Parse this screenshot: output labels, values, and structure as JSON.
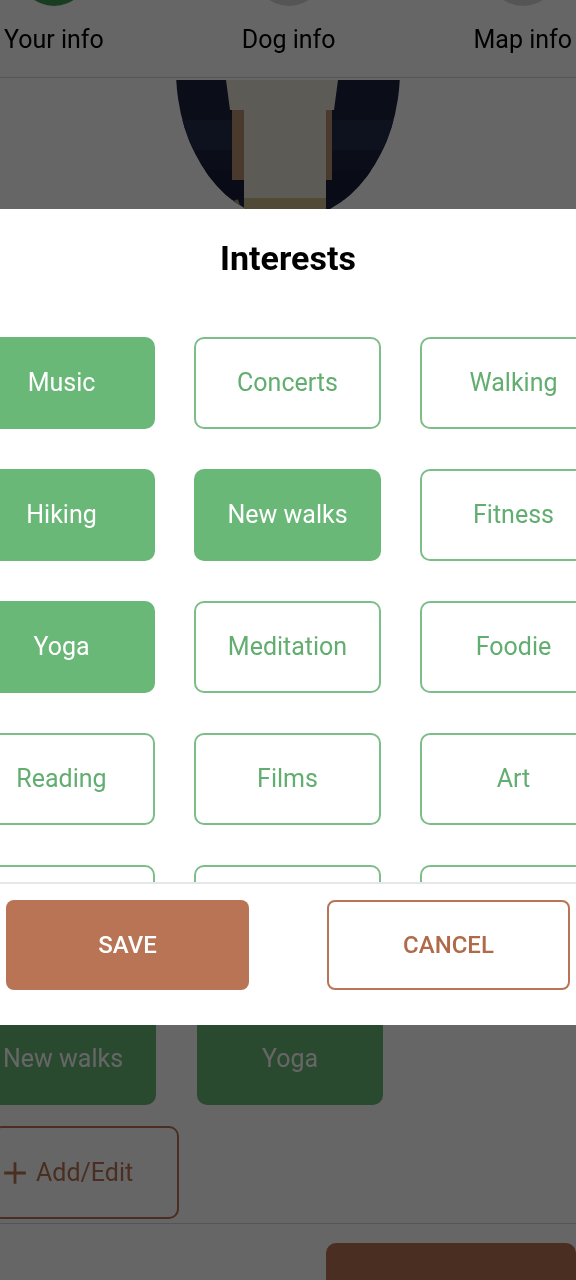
{
  "steps": [
    {
      "label": "Your info",
      "selected": true
    },
    {
      "label": "Dog info",
      "selected": false
    },
    {
      "label": "Map info",
      "selected": false
    }
  ],
  "dialog": {
    "title": "Interests",
    "interests": [
      {
        "label": "Music",
        "selected": true
      },
      {
        "label": "Concerts",
        "selected": false
      },
      {
        "label": "Walking",
        "selected": false
      },
      {
        "label": "Hiking",
        "selected": true
      },
      {
        "label": "New walks",
        "selected": true
      },
      {
        "label": "Fitness",
        "selected": false
      },
      {
        "label": "Yoga",
        "selected": true
      },
      {
        "label": "Meditation",
        "selected": false
      },
      {
        "label": "Foodie",
        "selected": false
      },
      {
        "label": "Reading",
        "selected": false
      },
      {
        "label": "Films",
        "selected": false
      },
      {
        "label": "Art",
        "selected": false
      },
      {
        "selected": false
      },
      {
        "selected": false
      },
      {
        "selected": false
      }
    ],
    "buttons": [
      {
        "label": "SAVE",
        "kind": "primary"
      },
      {
        "label": "CANCEL",
        "kind": "outline"
      }
    ]
  },
  "selected_interests": [
    {
      "label": "New walks"
    },
    {
      "label": "Yoga"
    }
  ],
  "add_button": {
    "label": "Add/Edit"
  }
}
